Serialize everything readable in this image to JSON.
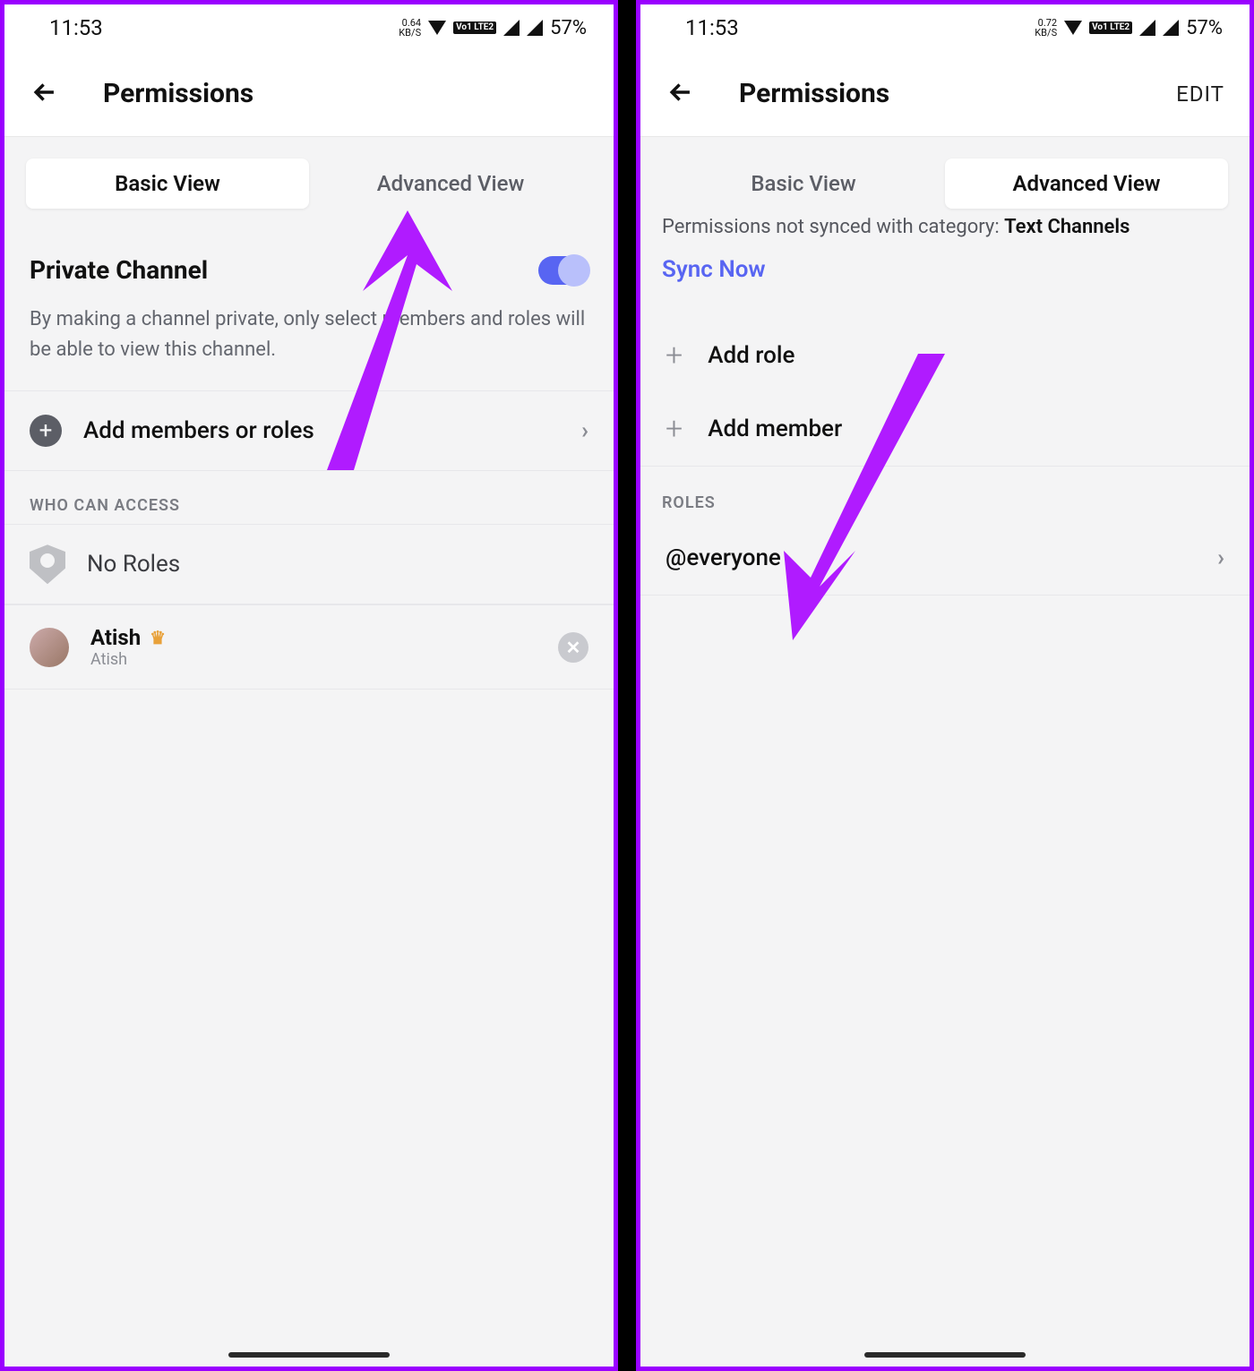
{
  "left": {
    "status": {
      "time": "11:53",
      "kbs": "0.64",
      "kbs_unit": "KB/S",
      "lte": "Vo1 LTE2",
      "battery": "57%"
    },
    "header": {
      "title": "Permissions"
    },
    "tabs": {
      "basic": "Basic View",
      "advanced": "Advanced View"
    },
    "private": {
      "title": "Private Channel",
      "desc": "By making a channel private, only select members and roles will be able to view this channel."
    },
    "add_members": "Add members or roles",
    "who_can_access": "WHO CAN ACCESS",
    "no_roles": "No Roles",
    "member": {
      "name": "Atish",
      "sub": "Atish"
    }
  },
  "right": {
    "status": {
      "time": "11:53",
      "kbs": "0.72",
      "kbs_unit": "KB/S",
      "lte": "Vo1 LTE2",
      "battery": "57%"
    },
    "header": {
      "title": "Permissions",
      "edit": "EDIT"
    },
    "tabs": {
      "basic": "Basic View",
      "advanced": "Advanced View"
    },
    "sync_prefix": "Permissions not synced with category: ",
    "sync_category": "Text Channels",
    "sync_now": "Sync Now",
    "add_role": "Add role",
    "add_member": "Add member",
    "roles_label": "ROLES",
    "everyone": "@everyone"
  }
}
